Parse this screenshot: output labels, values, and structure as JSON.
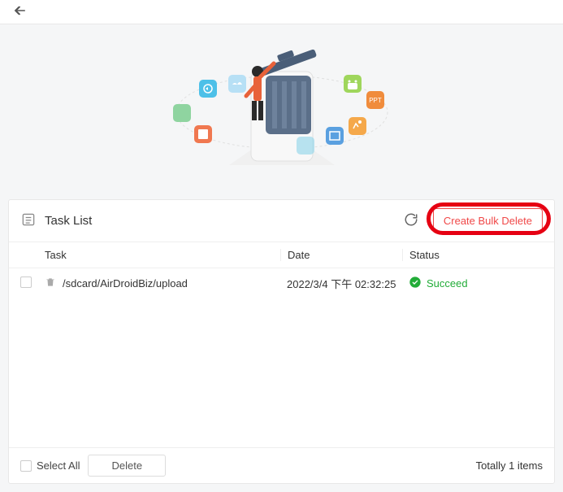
{
  "header": {
    "title": "Task List",
    "create_button": "Create Bulk Delete"
  },
  "columns": {
    "task": "Task",
    "date": "Date",
    "status": "Status"
  },
  "rows": [
    {
      "path": "/sdcard/AirDroidBiz/upload",
      "date": "2022/3/4 下午 02:32:25",
      "status": "Succeed"
    }
  ],
  "footer": {
    "select_all": "Select All",
    "delete": "Delete",
    "total": "Totally 1 items"
  },
  "colors": {
    "accent_red": "#f04848",
    "highlight": "#e60012",
    "success": "#22ac38"
  }
}
